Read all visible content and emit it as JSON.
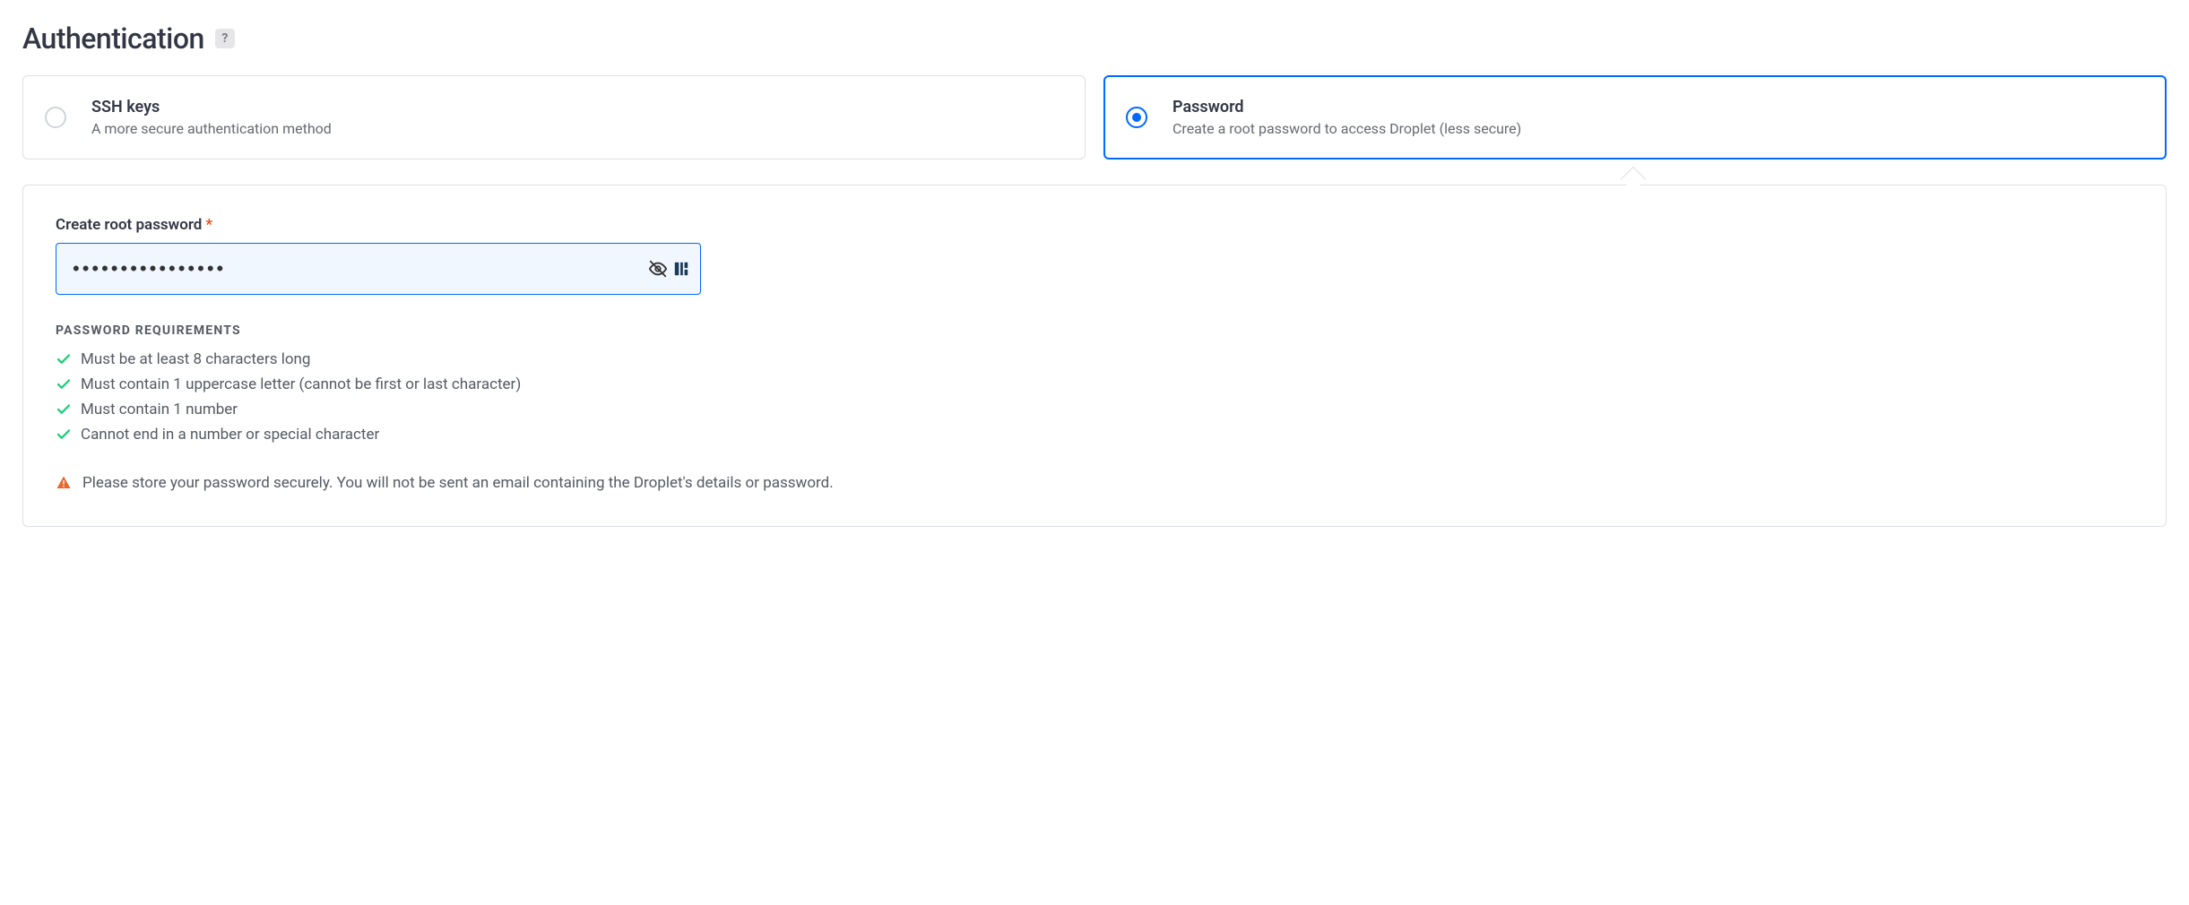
{
  "header": {
    "title": "Authentication",
    "help_symbol": "?"
  },
  "options": {
    "ssh": {
      "title": "SSH keys",
      "subtitle": "A more secure authentication method"
    },
    "password": {
      "title": "Password",
      "subtitle": "Create a root password to access Droplet (less secure)"
    }
  },
  "password_form": {
    "label": "Create root password",
    "required_mark": "*",
    "value": "••••••••••••••••",
    "requirements_header": "PASSWORD REQUIREMENTS",
    "requirements": [
      "Must be at least 8 characters long",
      "Must contain 1 uppercase letter (cannot be first or last character)",
      "Must contain 1 number",
      "Cannot end in a number or special character"
    ],
    "warning": "Please store your password securely. You will not be sent an email containing the Droplet's details or password."
  }
}
